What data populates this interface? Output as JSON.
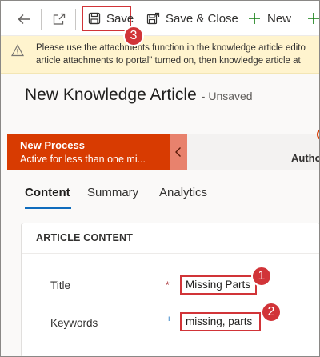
{
  "command_bar": {
    "save_label": "Save",
    "save_close_label": "Save & Close",
    "new_label": "New"
  },
  "banner": {
    "line1": "Please use the attachments function in the knowledge article edito",
    "line2": "article attachments to portal\" turned on, then knowledge article at"
  },
  "header": {
    "title": "New Knowledge Article",
    "status": "- Unsaved"
  },
  "process": {
    "stage_name": "New Process",
    "stage_desc": "Active for less than one mi...",
    "next_stage": "Author"
  },
  "tabs": [
    {
      "label": "Content",
      "active": true
    },
    {
      "label": "Summary",
      "active": false
    },
    {
      "label": "Analytics",
      "active": false
    }
  ],
  "section": {
    "title": "ARTICLE CONTENT",
    "fields": [
      {
        "label": "Title",
        "value": "Missing Parts",
        "indicator": "*"
      },
      {
        "label": "Keywords",
        "value": "missing, parts",
        "indicator": "+"
      }
    ]
  },
  "callouts": [
    "1",
    "2",
    "3"
  ],
  "colors": {
    "accent": "#0f6cbd",
    "highlight": "#d13438",
    "stage": "#d83b01",
    "banner_bg": "#fff4ce"
  },
  "icons": [
    "back-arrow-icon",
    "popout-icon",
    "save-icon",
    "save-close-icon",
    "plus-icon",
    "warning-icon",
    "chevron-left-icon"
  ]
}
